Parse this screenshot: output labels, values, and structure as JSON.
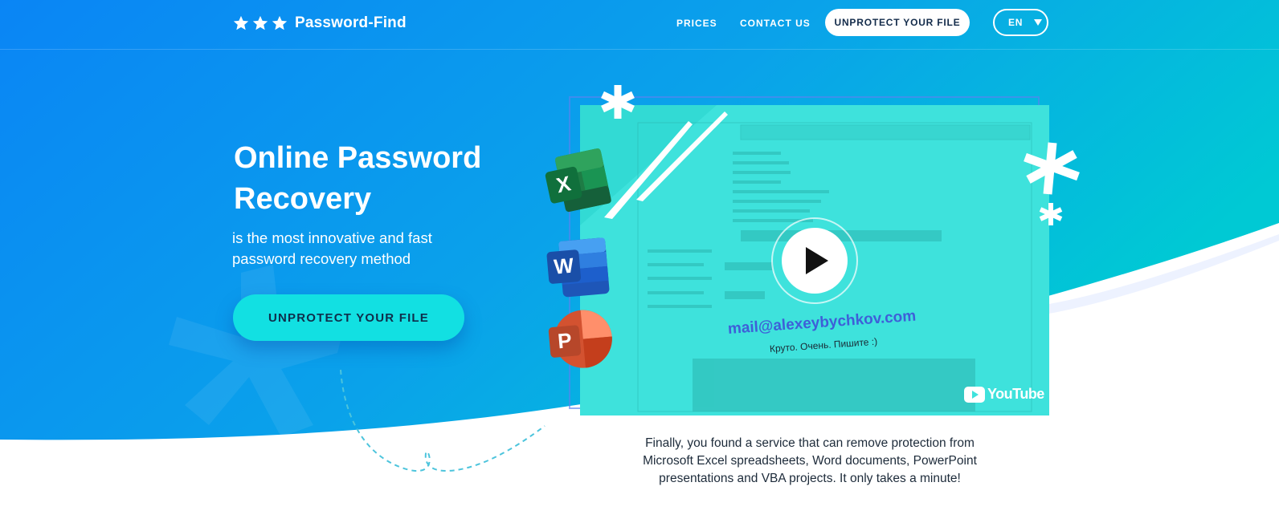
{
  "header": {
    "logo_text": "Password-Find",
    "nav": {
      "prices": "PRICES",
      "contact": "CONTACT US"
    },
    "cta_label": "UNPROTECT YOUR FILE",
    "language": "EN"
  },
  "hero": {
    "title": "Online Password Recovery",
    "subtitle": "is the most innovative and fast password recovery method",
    "button_label": "UNPROTECT YOUR FILE"
  },
  "video": {
    "watermark": "mail@alexeybychkov.com",
    "caption": "Круто. Очень. Пишите :)",
    "platform": "YouTube"
  },
  "tagline": "Finally, you found a service that can remove protection from Microsoft Excel spreadsheets, Word documents, PowerPoint presentations and VBA projects. It only takes a minute!",
  "icons": [
    "star-icon",
    "chevron-down-icon",
    "play-icon",
    "excel-icon",
    "word-icon",
    "powerpoint-icon",
    "youtube-icon"
  ],
  "colors": {
    "gradient_start": "#0a85f5",
    "gradient_end": "#00c6d6",
    "cta_teal": "#12e0e2",
    "video_overlay": "#3ee2dc",
    "text_dark": "#1d2b3a"
  }
}
